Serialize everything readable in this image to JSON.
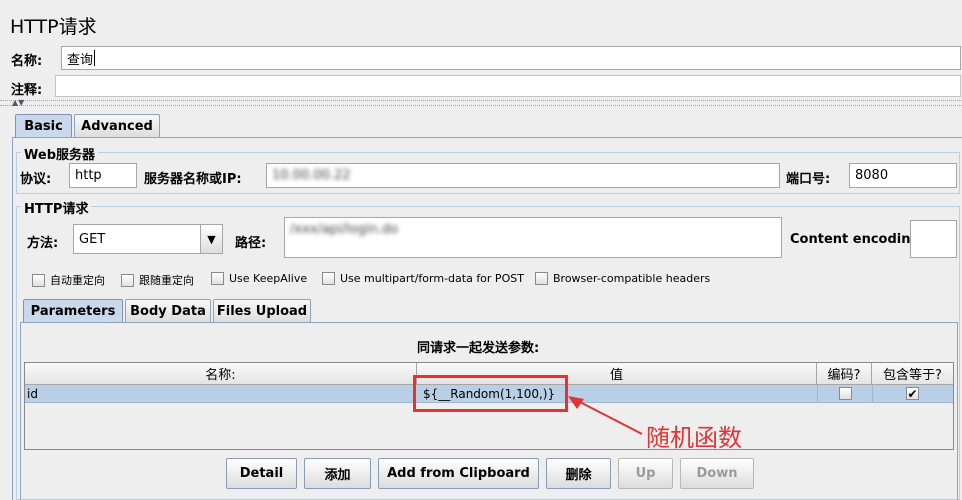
{
  "window": {
    "title": "HTTP请求"
  },
  "name_field": {
    "label": "名称:",
    "value": "查询"
  },
  "comment_field": {
    "label": "注释:",
    "value": ""
  },
  "tabs": [
    {
      "label": "Basic",
      "active": true
    },
    {
      "label": "Advanced",
      "active": false
    }
  ],
  "web_server": {
    "group_title": "Web服务器",
    "protocol_label": "协议:",
    "protocol_value": "http",
    "server_label": "服务器名称或IP:",
    "server_value": "10.00.00.22",
    "port_label": "端口号:",
    "port_value": "8080"
  },
  "http_request": {
    "group_title": "HTTP请求",
    "method_label": "方法:",
    "method_value": "GET",
    "path_label": "路径:",
    "path_value": "/xxx/api/login.do",
    "encoding_label": "Content encoding:",
    "encoding_value": ""
  },
  "options": [
    {
      "label": "自动重定向",
      "checked": false
    },
    {
      "label": "跟随重定向",
      "checked": false
    },
    {
      "label": "Use KeepAlive",
      "checked": false
    },
    {
      "label": "Use multipart/form-data for POST",
      "checked": false
    },
    {
      "label": "Browser-compatible headers",
      "checked": false
    }
  ],
  "sub_tabs": [
    {
      "label": "Parameters",
      "active": true
    },
    {
      "label": "Body Data",
      "active": false
    },
    {
      "label": "Files Upload",
      "active": false
    }
  ],
  "params_table": {
    "caption": "同请求一起发送参数:",
    "columns": [
      "名称:",
      "值",
      "编码?",
      "包含等于?"
    ],
    "rows": [
      {
        "name": "id",
        "value": "${__Random(1,100,)}",
        "encode": false,
        "include_equals": true
      }
    ]
  },
  "annotation": {
    "text": "随机函数",
    "color": "#e53333"
  },
  "buttons": {
    "detail": "Detail",
    "add": "添加",
    "add_clipboard": "Add from Clipboard",
    "delete": "删除",
    "up": "Up",
    "down": "Down"
  },
  "colors": {
    "selection": "#b8cfe5",
    "annotation": "#e53333",
    "tab_active": "#c9d8ea"
  }
}
